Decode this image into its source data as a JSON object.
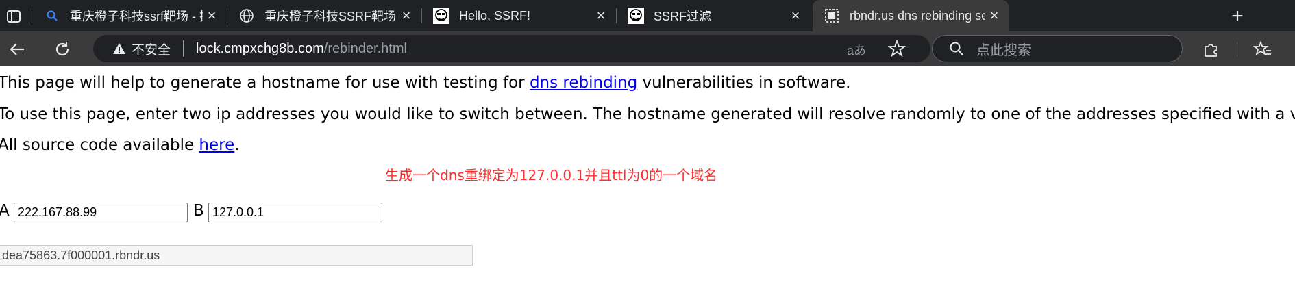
{
  "browser": {
    "tabs": [
      {
        "title": "重庆橙子科技ssrf靶场 - 搜索",
        "icon": "search-icon"
      },
      {
        "title": "重庆橙子科技SSRF靶场",
        "icon": "globe-icon"
      },
      {
        "title": "Hello, SSRF!",
        "icon": "avatar-icon"
      },
      {
        "title": "SSRF过滤",
        "icon": "avatar-icon"
      },
      {
        "title": "rbndr.us dns rebinding service",
        "icon": "page-icon",
        "active": true
      }
    ],
    "address": {
      "security_label": "不安全",
      "host": "lock.cmpxchg8b.com",
      "path": "/rebinder.html",
      "read_aloud": "aあ"
    },
    "search": {
      "placeholder": "点此搜索"
    },
    "colors": {
      "tabbar": "#202124",
      "toolbar": "#3b3b3b"
    }
  },
  "page": {
    "intro_before": "This page will help to generate a hostname for use with testing for ",
    "intro_link": "dns rebinding",
    "intro_after": " vulnerabilities in software.",
    "usage": "To use this page, enter two ip addresses you would like to switch between. The hostname generated will resolve randomly to one of the addresses specified with a ve",
    "source_before": "All source code available ",
    "source_link": "here",
    "source_after": ".",
    "annotation": "生成一个dns重绑定为127.0.0.1并且ttl为0的一个域名",
    "label_a": "A",
    "value_a": "222.167.88.99",
    "label_b": "B",
    "value_b": "127.0.0.1",
    "result": "dea75863.7f000001.rbndr.us",
    "colors": {
      "link": "#0000ee",
      "annotation": "#ff2d2d"
    }
  }
}
